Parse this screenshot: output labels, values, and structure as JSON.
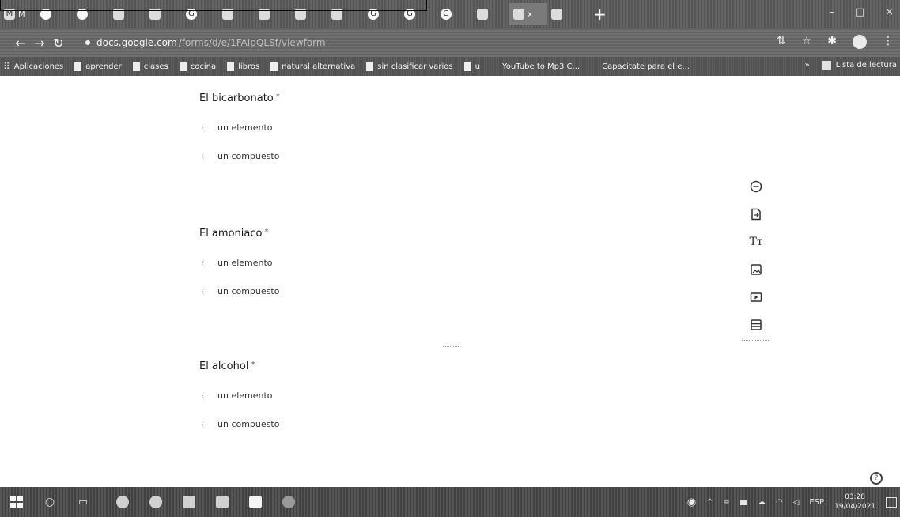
{
  "browser": {
    "tabs": [
      {
        "label": "M",
        "icon": "gmail-icon"
      },
      {
        "label": "",
        "icon": "site-icon"
      },
      {
        "label": "",
        "icon": "site-icon"
      },
      {
        "label": "",
        "icon": "page-icon"
      },
      {
        "label": "",
        "icon": "page-icon"
      },
      {
        "label": "",
        "icon": "google-icon"
      },
      {
        "label": "",
        "icon": "page-icon"
      },
      {
        "label": "",
        "icon": "page-icon"
      },
      {
        "label": "",
        "icon": "page-icon"
      },
      {
        "label": "",
        "icon": "page-icon"
      },
      {
        "label": "",
        "icon": "google-icon"
      },
      {
        "label": "",
        "icon": "google-icon"
      },
      {
        "label": "",
        "icon": "google-icon"
      },
      {
        "label": "",
        "icon": "page-icon"
      },
      {
        "label": "x",
        "icon": "forms-icon",
        "active": true
      },
      {
        "label": "",
        "icon": "page-icon"
      }
    ],
    "new_tab": "+",
    "window_controls": [
      "–",
      "□",
      "×"
    ],
    "address": {
      "domain": "docs.google.com",
      "path": "/forms/d/e/1FAIpQLSf/viewform"
    },
    "bookmarks": [
      {
        "label": "Aplicaciones",
        "icon": "apps-grid-icon"
      },
      {
        "label": "aprender",
        "icon": "folder-icon"
      },
      {
        "label": "clases",
        "icon": "folder-icon"
      },
      {
        "label": "cocina",
        "icon": "folder-icon"
      },
      {
        "label": "libros",
        "icon": "folder-icon"
      },
      {
        "label": "natural alternativa",
        "icon": "folder-icon"
      },
      {
        "label": "sin clasificar varios",
        "icon": "folder-icon"
      },
      {
        "label": "u",
        "icon": "folder-icon"
      },
      {
        "label": "YouTube to Mp3 C...",
        "icon": "page-icon"
      },
      {
        "label": "Capacitate para el e...",
        "icon": "page-icon"
      }
    ],
    "reading_list": "Lista de lectura"
  },
  "form": {
    "questions": [
      {
        "title": "El bicarbonato",
        "required": "*",
        "options": [
          "un elemento",
          "un compuesto"
        ]
      },
      {
        "title": "El amoniaco",
        "required": "*",
        "options": [
          "un elemento",
          "un compuesto"
        ]
      },
      {
        "title": "El alcohol",
        "required": "*",
        "options": [
          "un elemento",
          "un compuesto"
        ]
      }
    ],
    "tools": [
      {
        "icon": "add-question-icon"
      },
      {
        "icon": "import-questions-icon"
      },
      {
        "icon": "add-title-icon",
        "text": "Tт"
      },
      {
        "icon": "add-image-icon"
      },
      {
        "icon": "add-video-icon"
      },
      {
        "icon": "add-section-icon"
      }
    ],
    "help": "?"
  },
  "taskbar": {
    "clock_time": "03:28",
    "clock_date": "19/04/2021",
    "language": "ESP"
  }
}
